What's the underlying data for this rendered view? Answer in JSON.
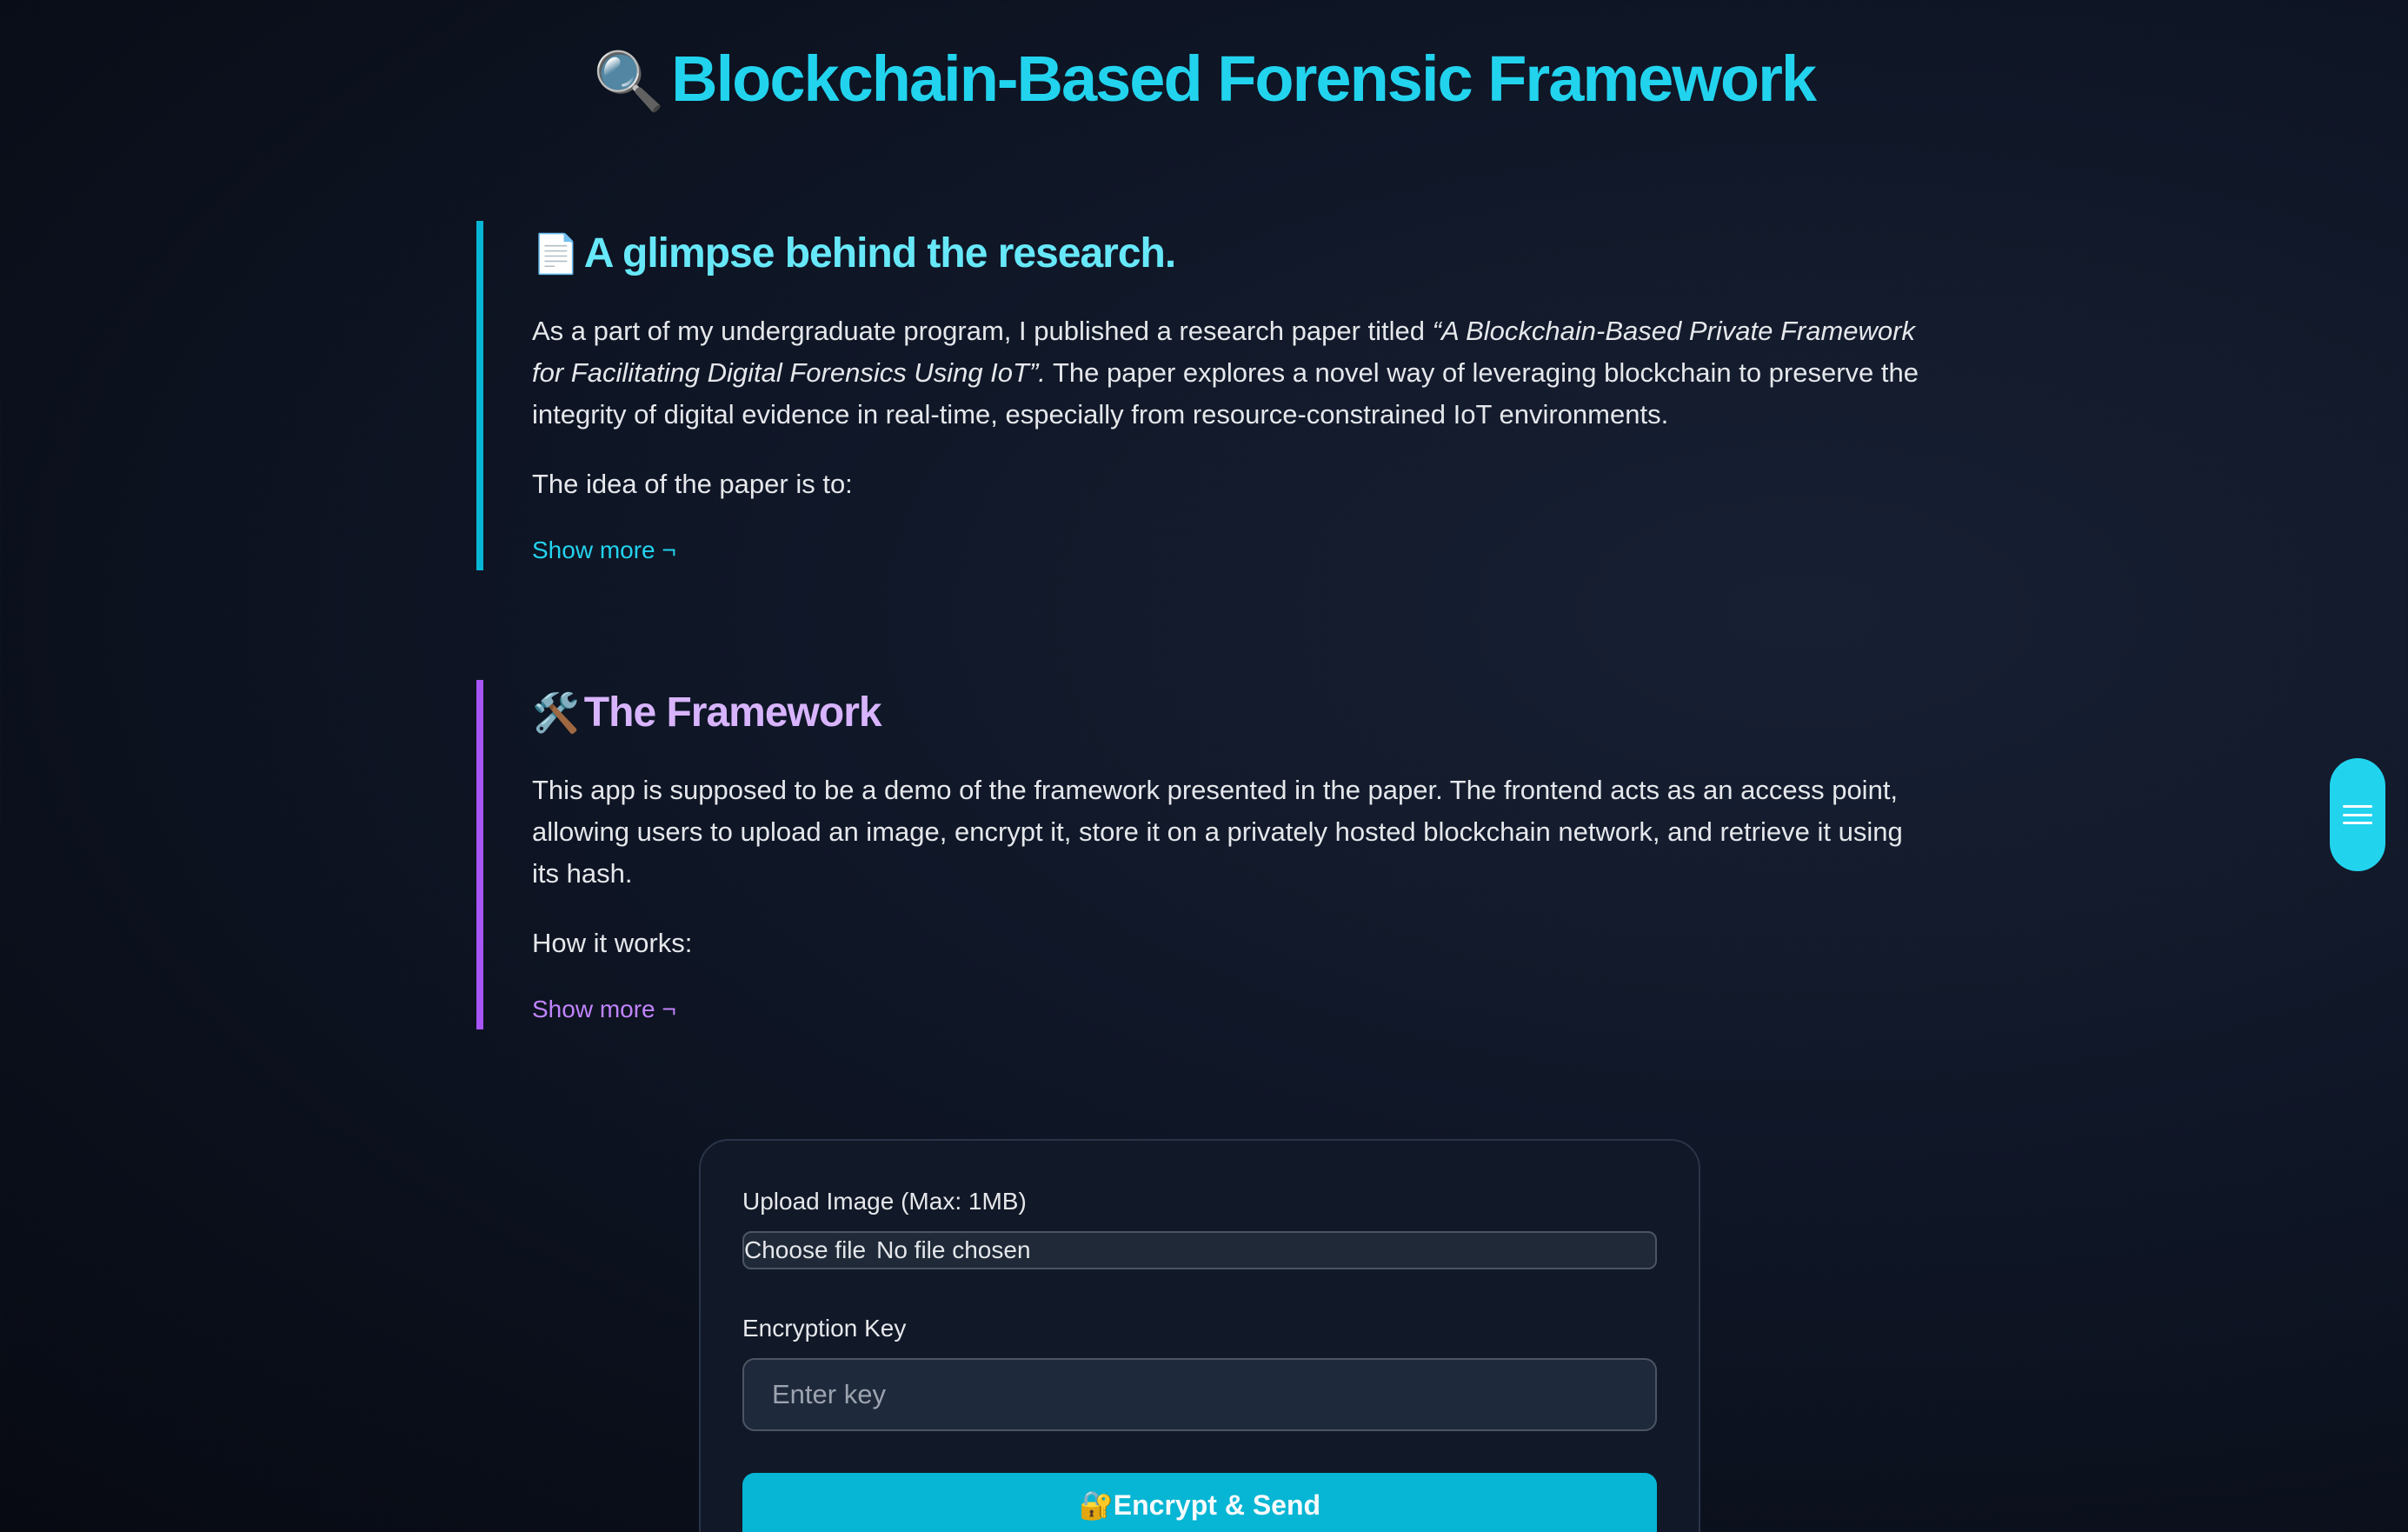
{
  "header": {
    "icon": "🔍",
    "title": "Blockchain-Based Forensic Framework"
  },
  "research": {
    "icon": "📄",
    "heading": "A glimpse behind the research.",
    "body_prefix": "As a part of my undergraduate program, I published a research paper titled ",
    "paper_title": "“A Blockchain-Based Private Framework for Facilitating Digital Forensics Using IoT”.",
    "body_suffix": " The paper explores a novel way of leveraging blockchain to preserve the integrity of digital evidence in real-time, especially from resource-constrained IoT environments.",
    "lead": "The idea of the paper is to:",
    "show_more": "Show more ¬"
  },
  "framework": {
    "icon": "🛠️",
    "heading": "The Framework",
    "body": "This app is supposed to be a demo of the framework presented in the paper. The frontend acts as an access point, allowing users to upload an image, encrypt it, store it on a privately hosted blockchain network, and retrieve it using its hash.",
    "lead": "How it works:",
    "show_more": "Show more ¬"
  },
  "upload_form": {
    "upload_label": "Upload Image (Max: 1MB)",
    "file_button": "Choose file",
    "file_status": "No file chosen",
    "key_label": "Encryption Key",
    "key_placeholder": "Enter key",
    "key_value": "",
    "submit_icon": "🔐",
    "submit_label": "Encrypt & Send"
  },
  "colors": {
    "accent_cyan": "#22d3ee",
    "accent_purple": "#a855f7",
    "card_bg": "#111827"
  },
  "icons": {
    "title": "magnifier-icon",
    "research": "document-icon",
    "framework": "tools-icon",
    "submit": "lock-key-icon",
    "menu": "hamburger-menu-icon"
  }
}
